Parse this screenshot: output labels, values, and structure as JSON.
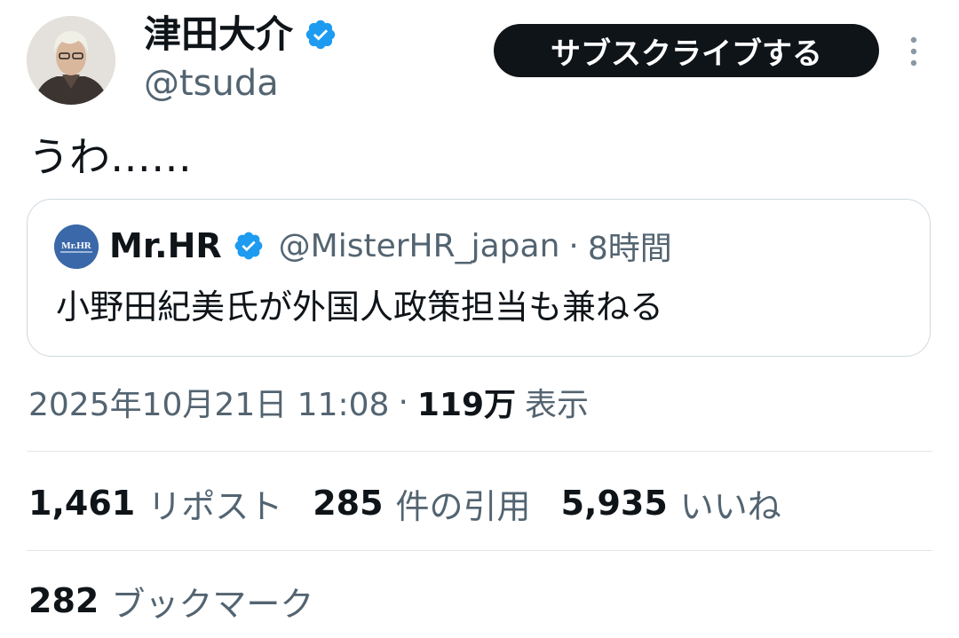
{
  "author": {
    "name": "津田大介",
    "handle": "@tsuda",
    "avatar_icon": "user-photo-avatar",
    "verified_icon": "verified-badge-icon"
  },
  "subscribe_label": "サブスクライブする",
  "tweet_text": "うわ……",
  "quote": {
    "name": "Mr.HR",
    "avatar_text": "Mr.HR",
    "handle": "@MisterHR_japan",
    "separator": "·",
    "time": "8時間",
    "text": "小野田紀美氏が外国人政策担当も兼ねる"
  },
  "meta": {
    "date": "2025年10月21日 11:08",
    "separator": "·",
    "views_count": "119万",
    "views_label": "表示"
  },
  "stats": {
    "reposts": {
      "count": "1,461",
      "label": "リポスト"
    },
    "quotes": {
      "count": "285",
      "label": "件の引用"
    },
    "likes": {
      "count": "5,935",
      "label": "いいね"
    },
    "bookmarks": {
      "count": "282",
      "label": "ブックマーク"
    }
  },
  "colors": {
    "text": "#0f1419",
    "secondary": "#536471",
    "verified": "#1d9bf0",
    "button_bg": "#0f1419",
    "border": "#cfd9de"
  }
}
